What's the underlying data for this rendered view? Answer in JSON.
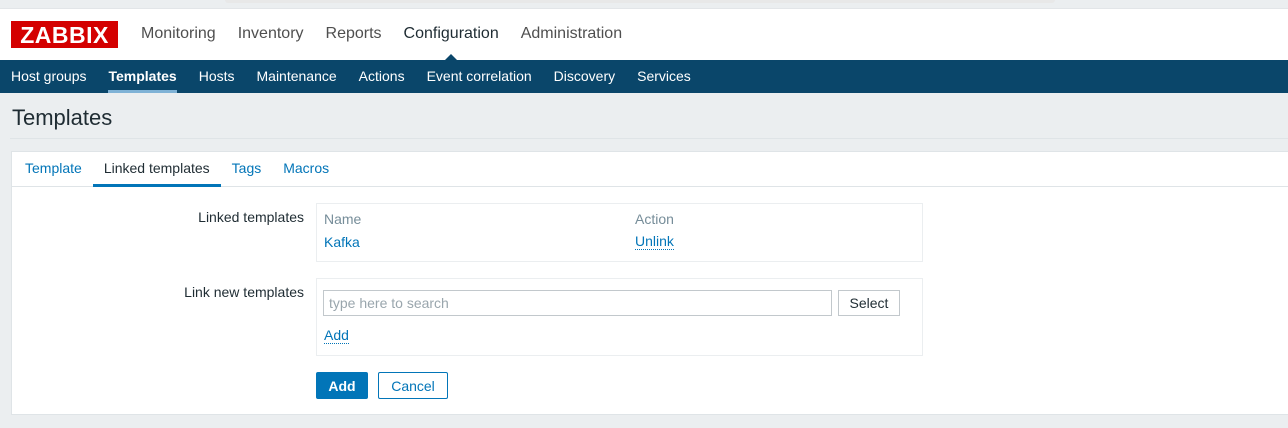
{
  "logo": {
    "text": "ZABBIX",
    "color": "#d40000"
  },
  "main_menu": [
    {
      "label": "Monitoring"
    },
    {
      "label": "Inventory"
    },
    {
      "label": "Reports"
    },
    {
      "label": "Configuration",
      "active": true
    },
    {
      "label": "Administration"
    }
  ],
  "sub_menu": [
    {
      "label": "Host groups"
    },
    {
      "label": "Templates",
      "active": true
    },
    {
      "label": "Hosts"
    },
    {
      "label": "Maintenance"
    },
    {
      "label": "Actions"
    },
    {
      "label": "Event correlation"
    },
    {
      "label": "Discovery"
    },
    {
      "label": "Services"
    }
  ],
  "page_title": "Templates",
  "tabs": [
    {
      "label": "Template"
    },
    {
      "label": "Linked templates",
      "active": true
    },
    {
      "label": "Tags"
    },
    {
      "label": "Macros"
    }
  ],
  "form": {
    "linked_templates_label": "Linked templates",
    "table": {
      "headers": {
        "name": "Name",
        "action": "Action"
      },
      "rows": [
        {
          "name": "Kafka",
          "action": "Unlink"
        }
      ]
    },
    "link_new_label": "Link new templates",
    "search_placeholder": "type here to search",
    "select_button": "Select",
    "add_link": "Add",
    "add_button": "Add",
    "cancel_button": "Cancel"
  },
  "colors": {
    "nav_bg": "#0a466a",
    "link": "#0275b8",
    "page_bg": "#ebeef0"
  }
}
